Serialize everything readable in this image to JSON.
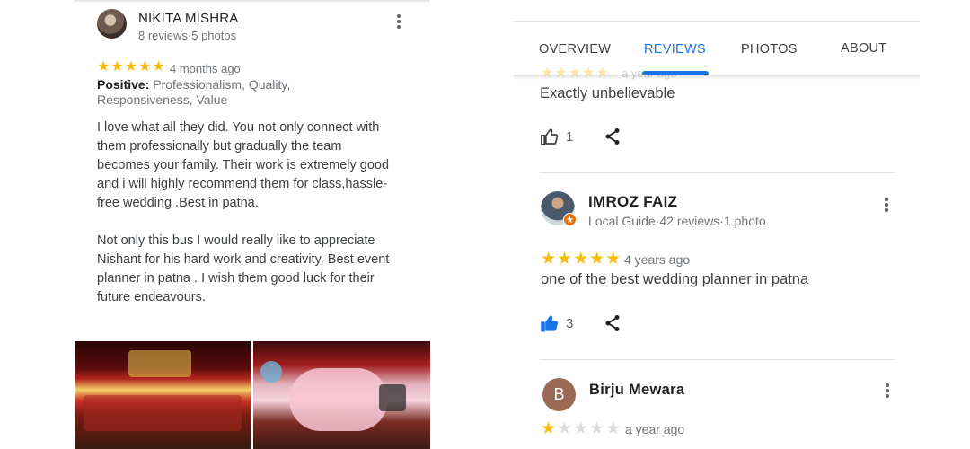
{
  "left_review": {
    "reviewer": "NIKITA MISHRA",
    "meta": "8 reviews·5 photos",
    "rating": 5,
    "time": "4 months ago",
    "positive_label": "Positive:",
    "positive_values": "Professionalism, Quality, Responsiveness, Value",
    "paragraphs": [
      "I love what  all they did. You not only connect with them  professionally but gradually the team becomes your family. Their work is extremely good and i will highly recommend them for class,hassle-free wedding .Best in patna.",
      "Not only this bus I would really like to appreciate Nishant for his hard work and creativity. Best event planner in patna . I wish them good luck for their future endeavours."
    ]
  },
  "tabs": [
    {
      "label": "OVERVIEW",
      "active": false
    },
    {
      "label": "REVIEWS",
      "active": true
    },
    {
      "label": "PHOTOS",
      "active": false
    },
    {
      "label": "ABOUT",
      "active": false
    }
  ],
  "previous_review": {
    "time": "a year ago",
    "text": "Exactly unbelievable",
    "likes": "1"
  },
  "imroz_review": {
    "reviewer": "IMROZ FAIZ",
    "meta": "Local Guide·42 reviews·1 photo",
    "rating": 5,
    "time": "4 years ago",
    "text": "one of the best wedding planner in patna",
    "likes": "3"
  },
  "birju_review": {
    "avatar_letter": "B",
    "reviewer": "Birju Mewara",
    "rating": 1,
    "time": "a year ago"
  },
  "colors": {
    "accent": "#1a73e8",
    "star": "#fbbc04",
    "star_empty": "#dadce0",
    "local_guide_badge": "#e8710a"
  },
  "icons": {
    "like": "thumbs-up-icon",
    "share": "share-icon",
    "more": "more-vert-icon",
    "badge": "local-guide-star-icon"
  }
}
